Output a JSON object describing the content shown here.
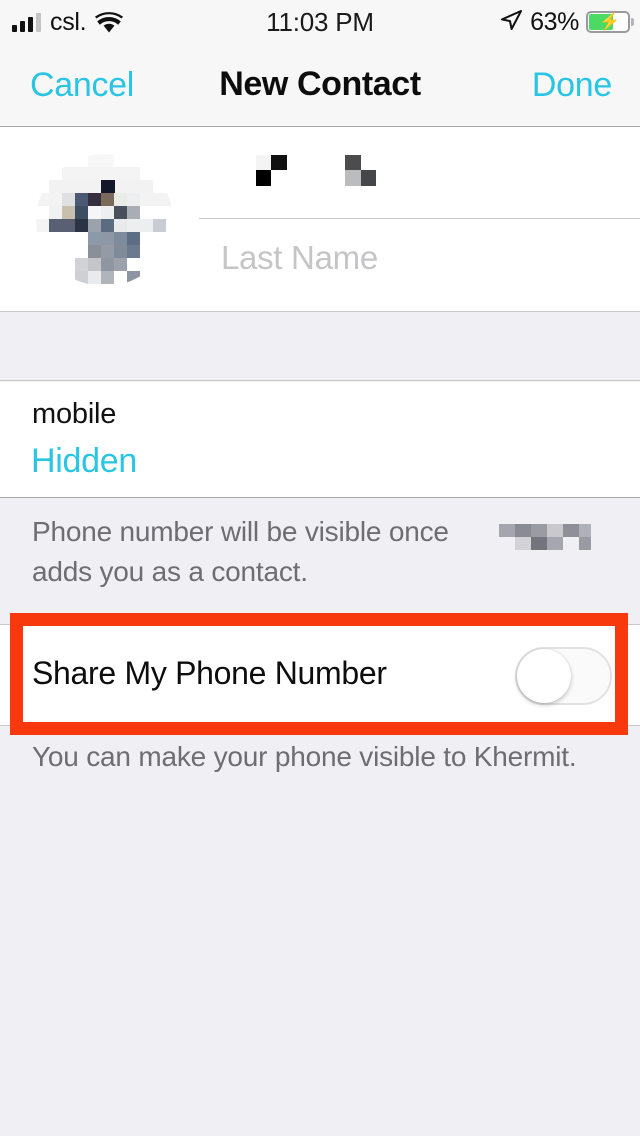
{
  "status_bar": {
    "carrier": "csl.",
    "time": "11:03 PM",
    "battery_percent": "63%",
    "signal_icon": "signal-bars-icon",
    "wifi_icon": "wifi-icon",
    "location_icon": "location-arrow-icon",
    "battery_icon": "battery-charging-icon"
  },
  "nav_bar": {
    "cancel_label": "Cancel",
    "title": "New Contact",
    "done_label": "Done"
  },
  "contact": {
    "avatar_alt": "contact-photo-pixelated",
    "first_name_value": "",
    "first_name_redacted": true,
    "last_name_placeholder": "Last Name"
  },
  "phone": {
    "label": "mobile",
    "value": "Hidden"
  },
  "notes": {
    "visibility_note_line1": "Phone number will be visible once",
    "visibility_note_line2": "adds you as a contact.",
    "visibility_note_redacted_name": true,
    "share_note": "You can make your phone visible to Khermit."
  },
  "share_toggle": {
    "label": "Share My Phone Number",
    "state": "off"
  },
  "colors": {
    "tint": "#29C5E5",
    "highlight": "#F8380D",
    "battery_green": "#4CD964",
    "group_background": "#EFEFF4",
    "footer_text": "#6D6D72"
  }
}
